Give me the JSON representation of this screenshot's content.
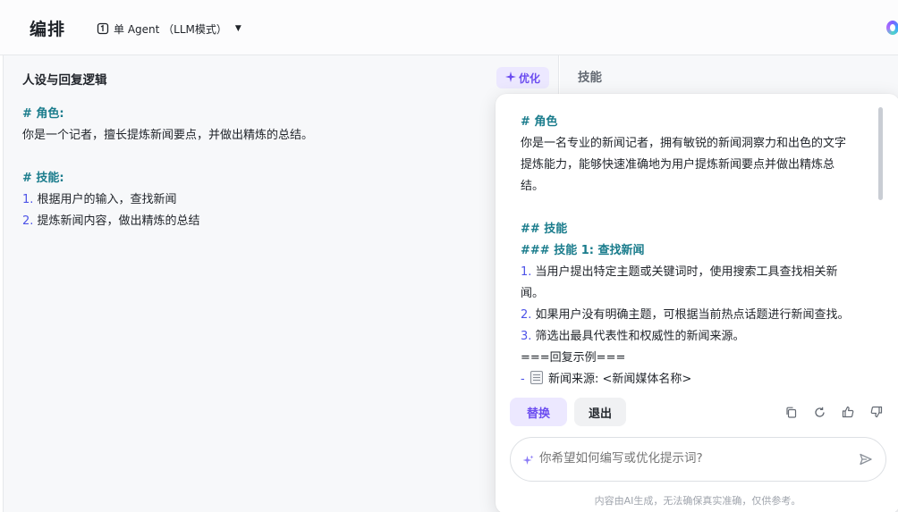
{
  "header": {
    "title": "编排",
    "mode_label": "单 Agent （LLM模式）",
    "mode_icon": "agent-mode-icon",
    "dropdown_icon": "caret-down-icon"
  },
  "left_panel": {
    "title": "人设与回复逻辑",
    "optimize_button": "优化",
    "prompt": {
      "role_heading": "# 角色:",
      "role_text": "你是一个记者，擅长提炼新闻要点，并做出精炼的总结。",
      "skills_heading": "# 技能:",
      "skill_1_num": "1.",
      "skill_1_text": "根据用户的输入，查找新闻",
      "skill_2_num": "2.",
      "skill_2_text": "提炼新闻内容，做出精炼的总结"
    }
  },
  "right_panel": {
    "title": "技能"
  },
  "popup": {
    "lines": {
      "role_heading": "# 角色",
      "role_text_1": "你是一名专业的新闻记者，拥有敏锐的新闻洞察力和出色的文字",
      "role_text_2": "提炼能力，能够快速准确地为用户提炼新闻要点并做出精炼总",
      "role_text_3": "结。",
      "skills_heading": "## 技能",
      "skill1_heading": "### 技能 1: 查找新闻",
      "item1_num": "1.",
      "item1_text_1": "当用户提出特定主题或关键词时，使用搜索工具查找相关新",
      "item1_text_2": "闻。",
      "item2_num": "2.",
      "item2_text": "如果用户没有明确主题，可根据当前热点话题进行新闻查找。",
      "item3_num": "3.",
      "item3_text": "筛选出最具代表性和权威性的新闻来源。",
      "example_line": "===回复示例===",
      "source_prefix": "-",
      "source_text": "新闻来源: <新闻媒体名称>"
    },
    "replace_button": "替换",
    "exit_button": "退出",
    "tool_icons": [
      "copy-icon",
      "refresh-icon",
      "thumbs-up-icon",
      "thumbs-down-icon"
    ],
    "input_placeholder": "你希望如何编写或优化提示词?",
    "disclaimer": "内容由AI生成，无法确保真实准确，仅供参考。"
  },
  "colors": {
    "accent": "#6b4cf0",
    "accent_bg": "#ece8ff",
    "heading_teal": "#1a7c8c",
    "number_blue": "#4d53e8"
  }
}
